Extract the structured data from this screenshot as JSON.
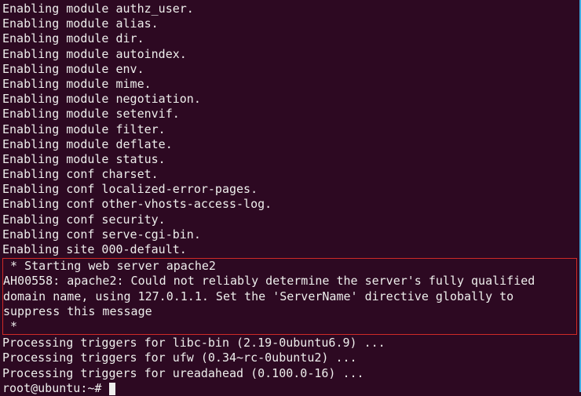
{
  "modules": [
    "Enabling module authz_user.",
    "Enabling module alias.",
    "Enabling module dir.",
    "Enabling module autoindex.",
    "Enabling module env.",
    "Enabling module mime.",
    "Enabling module negotiation.",
    "Enabling module setenvif.",
    "Enabling module filter.",
    "Enabling module deflate.",
    "Enabling module status.",
    "Enabling conf charset.",
    "Enabling conf localized-error-pages.",
    "Enabling conf other-vhosts-access-log.",
    "Enabling conf security.",
    "Enabling conf serve-cgi-bin.",
    "Enabling site 000-default."
  ],
  "highlighted": {
    "l1": " * Starting web server apache2",
    "l2": "AH00558: apache2: Could not reliably determine the server's fully qualified domain name, using 127.0.1.1. Set the 'ServerName' directive globally to suppress this message",
    "l3": " *"
  },
  "triggers": [
    "Processing triggers for libc-bin (2.19-0ubuntu6.9) ...",
    "Processing triggers for ufw (0.34~rc-0ubuntu2) ...",
    "Processing triggers for ureadahead (0.100.0-16) ..."
  ],
  "prompt": "root@ubuntu:~# "
}
